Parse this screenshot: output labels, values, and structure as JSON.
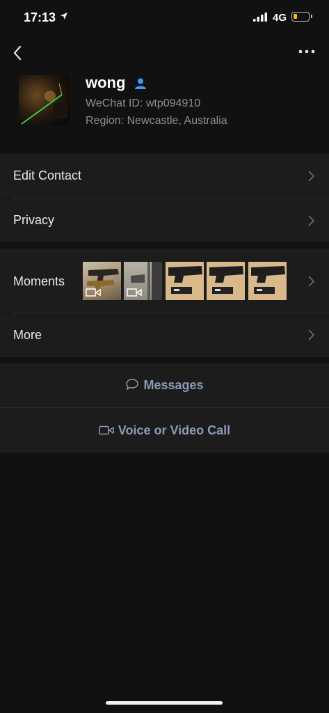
{
  "status_bar": {
    "time": "17:13",
    "network": "4G",
    "battery_level": 0.25,
    "battery_color": "#f2c200"
  },
  "nav": {
    "back_icon": "chevron-left-icon",
    "more_icon": "ellipsis-icon"
  },
  "profile": {
    "name": "wong",
    "wechat_id": "WeChat ID: wtp094910",
    "region": "Region: Newcastle, Australia",
    "badge_icon": "person-icon",
    "badge_color": "#3a9bf5"
  },
  "menu": {
    "edit_contact": "Edit Contact",
    "privacy": "Privacy",
    "moments": "Moments",
    "more": "More"
  },
  "moments_thumbnails": [
    {
      "icon": "video-icon"
    },
    {
      "icon": "video-icon"
    },
    {
      "icon": ""
    },
    {
      "icon": ""
    },
    {
      "icon": ""
    }
  ],
  "actions": {
    "messages": "Messages",
    "messages_icon": "chat-bubble-icon",
    "call": "Voice or Video Call",
    "call_icon": "video-camera-icon",
    "accent_color": "#8b9bb5"
  }
}
